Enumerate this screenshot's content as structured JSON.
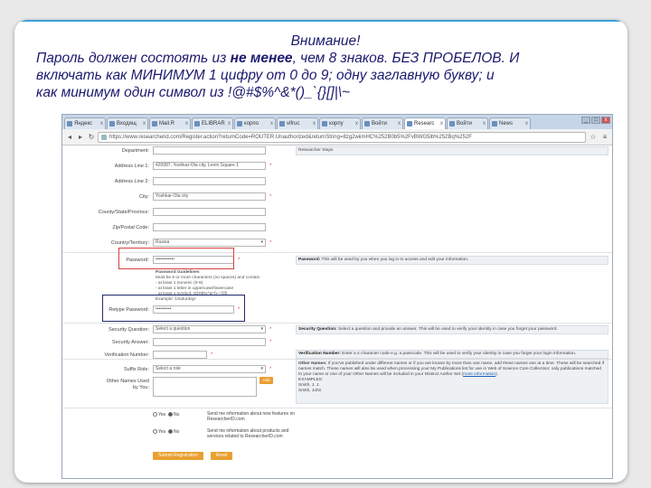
{
  "note": {
    "title": "Внимание!",
    "line1_pre": "Пароль должен состоять из ",
    "line1_bold": "не менее",
    "line1_post": ", чем 8 знаков. БЕЗ ПРОБЕЛОВ. И",
    "line2": "включать как МИНИМУМ 1 цифру от 0 до 9; одну заглавную букву; и",
    "line3": "как минимум один символ из !@#$%^&*()_`{}[]|\\~"
  },
  "browser": {
    "tabs": [
      {
        "label": "Яндекс",
        "active": false
      },
      {
        "label": "Входящ",
        "active": false
      },
      {
        "label": "Mail.R",
        "active": false
      },
      {
        "label": "ELIBRAR",
        "active": false
      },
      {
        "label": "корпо",
        "active": false
      },
      {
        "label": "vifruc",
        "active": false
      },
      {
        "label": "корпу",
        "active": false
      },
      {
        "label": "Войти",
        "active": false
      },
      {
        "label": "Researc",
        "active": true
      },
      {
        "label": "Войти",
        "active": false
      },
      {
        "label": "News",
        "active": false
      }
    ],
    "url": "https://www.researcherid.com/Register.action?returnCode=ROUTER.Unauthorized&returnString=8zg2wiimHC%252B0b5%2FvBWG5lb%252Bq%252F",
    "close_glyph": "x",
    "min_glyph": "_",
    "max_glyph": "□",
    "back_glyph": "◂",
    "fwd_glyph": "▸",
    "reload_glyph": "↻",
    "star_glyph": "☆",
    "menu_glyph": "≡"
  },
  "form": {
    "top_row": {
      "label": "Department:",
      "help": "Researcher Steps"
    },
    "address1": {
      "label": "Address Line 1:",
      "value": "420087, Yoshkar-Ola city, Lenin Square 1"
    },
    "address2": {
      "label": "Address Line 2:",
      "value": ""
    },
    "city": {
      "label": "City:",
      "value": "Yoshkar-Ola city"
    },
    "county": {
      "label": "County/State/Province:",
      "value": ""
    },
    "zip": {
      "label": "Zip/Postal Code:",
      "value": ""
    },
    "country": {
      "label": "Country/Territory:",
      "value": "Russia"
    },
    "password": {
      "label": "Password:",
      "value": "••••••••••••",
      "help_bold": "Password:",
      "help": " This will be used by you when you log in to access and edit your information."
    },
    "pw_guidelines": {
      "title": "Password Guidelines",
      "lines": [
        "Must be 8 or more characters (no spaces) and contain",
        "- at least 1 numeric (0-9)",
        "- at least 1 letter in uppercase/lowercase",
        "- at least 1 symbol: !@#$%^&*()~`{}[]|",
        "Example: 1Saturday!"
      ]
    },
    "retype": {
      "label": "Retype Password:",
      "value": "••••••••••"
    },
    "sec_question": {
      "label": "Security Question:",
      "value": "Select a question",
      "help_bold": "Security Question:",
      "help": " Select a question and provide an answer. This will be used to verify your identity in case you forget your password."
    },
    "sec_answer": {
      "label": "Security Answer:",
      "value": ""
    },
    "verification": {
      "label": "Verification Number:",
      "value": "",
      "help_bold": "Verification Number:",
      "help": " Enter a 4 character code e.g. a passcode. This will be used to verify your identity in case you forget your login information."
    },
    "suffix": {
      "label": "Suffix Role:",
      "value": "Select a role"
    },
    "other_names": {
      "label_line1": "Other Names Used",
      "label_line2": "by You:",
      "add_label": "Add",
      "help_bold": "Other Names:",
      "help": " If you've published under different names or if you are known by more than one name, add these names one at a time. These will be searched if names match. These names will also be used when processing your My Publications list for use in Web of Science Core Collection; only publications matched to your name or one of your Other Names will be included in your Distinct Author Set (",
      "help_link": "more information",
      "help_end": ").",
      "examples": [
        "EXAMPLES:",
        "Smith, J. J.",
        "Smith, John"
      ]
    },
    "opt1": {
      "yes": "Yes",
      "no": "No",
      "desc": "Send me information about new features on ResearcherID.com"
    },
    "opt2": {
      "yes": "Yes",
      "no": "No",
      "desc": "Send me information about products and services related to ResearcherID.com"
    },
    "submit_label": "Submit Registration",
    "reset_label": "Reset",
    "req_mark": "*"
  },
  "colors": {
    "note_text": "#1a1a6e",
    "red_box": "#d84040",
    "dark_box": "#1e2a6e",
    "orange_button": "#e8a030"
  }
}
